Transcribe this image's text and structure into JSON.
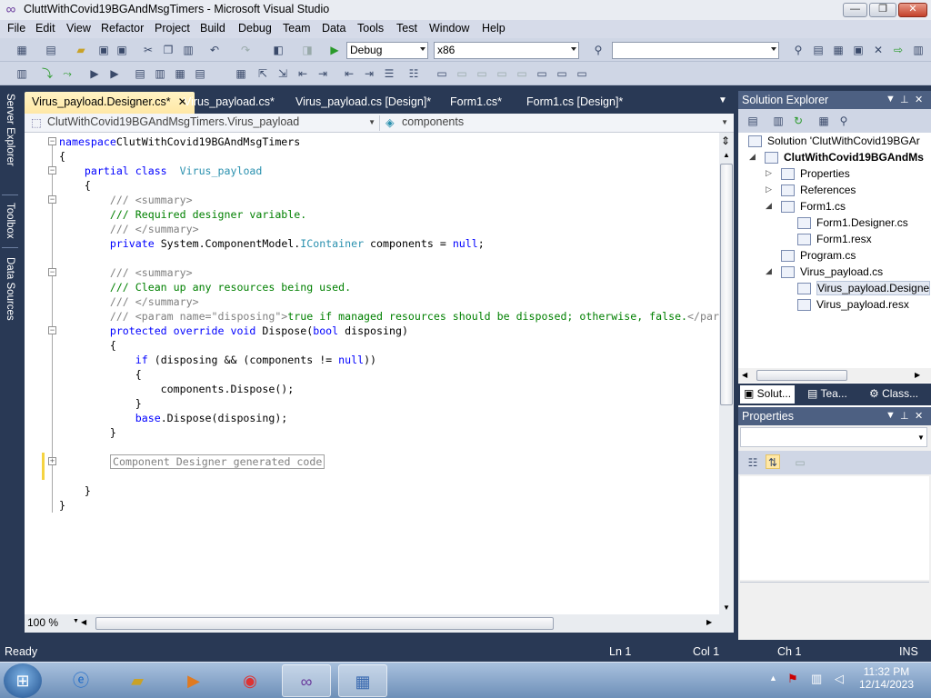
{
  "window": {
    "title": "CluttWithCovid19BGAndMsgTimers - Microsoft Visual Studio",
    "minimize_label": "—",
    "maximize_label": "❐",
    "close_label": "✕"
  },
  "menu": [
    "File",
    "Edit",
    "View",
    "Refactor",
    "Project",
    "Build",
    "Debug",
    "Team",
    "Data",
    "Tools",
    "Test",
    "Window",
    "Help"
  ],
  "toolbar": {
    "configuration": "Debug",
    "platform": "x86",
    "find_value": ""
  },
  "left_dock": [
    "Server Explorer",
    "Toolbox",
    "Data Sources"
  ],
  "tabs": [
    {
      "label": "Virus_payload.Designer.cs*",
      "active": true
    },
    {
      "label": "Virus_payload.cs*",
      "active": false
    },
    {
      "label": "Virus_payload.cs [Design]*",
      "active": false
    },
    {
      "label": "Form1.cs*",
      "active": false
    },
    {
      "label": "Form1.cs [Design]*",
      "active": false
    }
  ],
  "tab_close": "✕",
  "navbar": {
    "type_selector": "ClutWithCovid19BGAndMsgTimers.Virus_payload",
    "member_selector": "components"
  },
  "code": [
    {
      "t": [
        [
          "kw",
          "namespace"
        ],
        [
          "",
          "ClutWithCovid19BGAndMsgTimers"
        ]
      ]
    },
    {
      "t": [
        [
          "",
          "{"
        ]
      ]
    },
    {
      "t": [
        [
          "",
          "    "
        ],
        [
          "kw",
          "partial class"
        ],
        [
          "",
          "  "
        ],
        [
          "ty",
          "Virus_payload"
        ]
      ]
    },
    {
      "t": [
        [
          "",
          "    {"
        ]
      ]
    },
    {
      "t": [
        [
          "",
          "        "
        ],
        [
          "dc",
          "/// <summary>"
        ]
      ]
    },
    {
      "t": [
        [
          "",
          "        "
        ],
        [
          "cm",
          "/// Required designer variable."
        ]
      ]
    },
    {
      "t": [
        [
          "",
          "        "
        ],
        [
          "dc",
          "/// </summary>"
        ]
      ]
    },
    {
      "t": [
        [
          "",
          "        "
        ],
        [
          "kw",
          "private"
        ],
        [
          "",
          " System.ComponentModel."
        ],
        [
          "ty",
          "IContainer"
        ],
        [
          "",
          " components = "
        ],
        [
          "kw",
          "null"
        ],
        [
          "",
          ";"
        ]
      ]
    },
    {
      "t": [
        [
          "",
          ""
        ]
      ]
    },
    {
      "t": [
        [
          "",
          "        "
        ],
        [
          "dc",
          "/// <summary>"
        ]
      ]
    },
    {
      "t": [
        [
          "",
          "        "
        ],
        [
          "cm",
          "/// Clean up any resources being used."
        ]
      ]
    },
    {
      "t": [
        [
          "",
          "        "
        ],
        [
          "dc",
          "/// </summary>"
        ]
      ]
    },
    {
      "t": [
        [
          "",
          "        "
        ],
        [
          "dc",
          "/// <param name=\"disposing\">"
        ],
        [
          "cm",
          "true if managed resources should be disposed; otherwise, false."
        ],
        [
          "dc",
          "</par"
        ]
      ]
    },
    {
      "t": [
        [
          "",
          "        "
        ],
        [
          "kw",
          "protected override void"
        ],
        [
          "",
          " Dispose("
        ],
        [
          "kw",
          "bool"
        ],
        [
          "",
          " disposing)"
        ]
      ]
    },
    {
      "t": [
        [
          "",
          "        {"
        ]
      ]
    },
    {
      "t": [
        [
          "",
          "            "
        ],
        [
          "kw",
          "if"
        ],
        [
          "",
          " (disposing && (components != "
        ],
        [
          "kw",
          "null"
        ],
        [
          "",
          "))"
        ]
      ]
    },
    {
      "t": [
        [
          "",
          "            {"
        ]
      ]
    },
    {
      "t": [
        [
          "",
          "                components.Dispose();"
        ]
      ]
    },
    {
      "t": [
        [
          "",
          "            }"
        ]
      ]
    },
    {
      "t": [
        [
          "",
          "            "
        ],
        [
          "kw",
          "base"
        ],
        [
          "",
          ".Dispose(disposing);"
        ]
      ]
    },
    {
      "t": [
        [
          "",
          "        }"
        ]
      ]
    },
    {
      "t": [
        [
          "",
          ""
        ]
      ]
    },
    {
      "t": [
        [
          "",
          ""
        ]
      ]
    },
    {
      "t": [
        [
          "",
          ""
        ]
      ]
    },
    {
      "t": [
        [
          "",
          "    }"
        ]
      ]
    },
    {
      "t": [
        [
          "",
          "}"
        ]
      ]
    }
  ],
  "collapsed_region": "Component Designer generated code",
  "zoom": "100 %",
  "solution_explorer": {
    "title": "Solution Explorer",
    "items": [
      {
        "label": "Solution 'ClutWithCovid19BGAr",
        "level": 0,
        "bold": false
      },
      {
        "label": "ClutWithCovid19BGAndMs",
        "level": 1,
        "bold": true
      },
      {
        "label": "Properties",
        "level": 2,
        "bold": false
      },
      {
        "label": "References",
        "level": 2,
        "bold": false
      },
      {
        "label": "Form1.cs",
        "level": 2,
        "bold": false
      },
      {
        "label": "Form1.Designer.cs",
        "level": 3,
        "bold": false
      },
      {
        "label": "Form1.resx",
        "level": 3,
        "bold": false
      },
      {
        "label": "Program.cs",
        "level": 2,
        "bold": false
      },
      {
        "label": "Virus_payload.cs",
        "level": 2,
        "bold": false
      },
      {
        "label": "Virus_payload.Designe",
        "level": 3,
        "bold": false
      },
      {
        "label": "Virus_payload.resx",
        "level": 3,
        "bold": false
      }
    ],
    "tabs": [
      "Solut...",
      "Tea...",
      "Class..."
    ]
  },
  "properties_panel": {
    "title": "Properties"
  },
  "status": {
    "text": "Ready",
    "line": "Ln 1",
    "col": "Col 1",
    "ch": "Ch 1",
    "mode": "INS"
  },
  "taskbar": {
    "time": "11:32 PM",
    "date": "12/14/2023"
  }
}
